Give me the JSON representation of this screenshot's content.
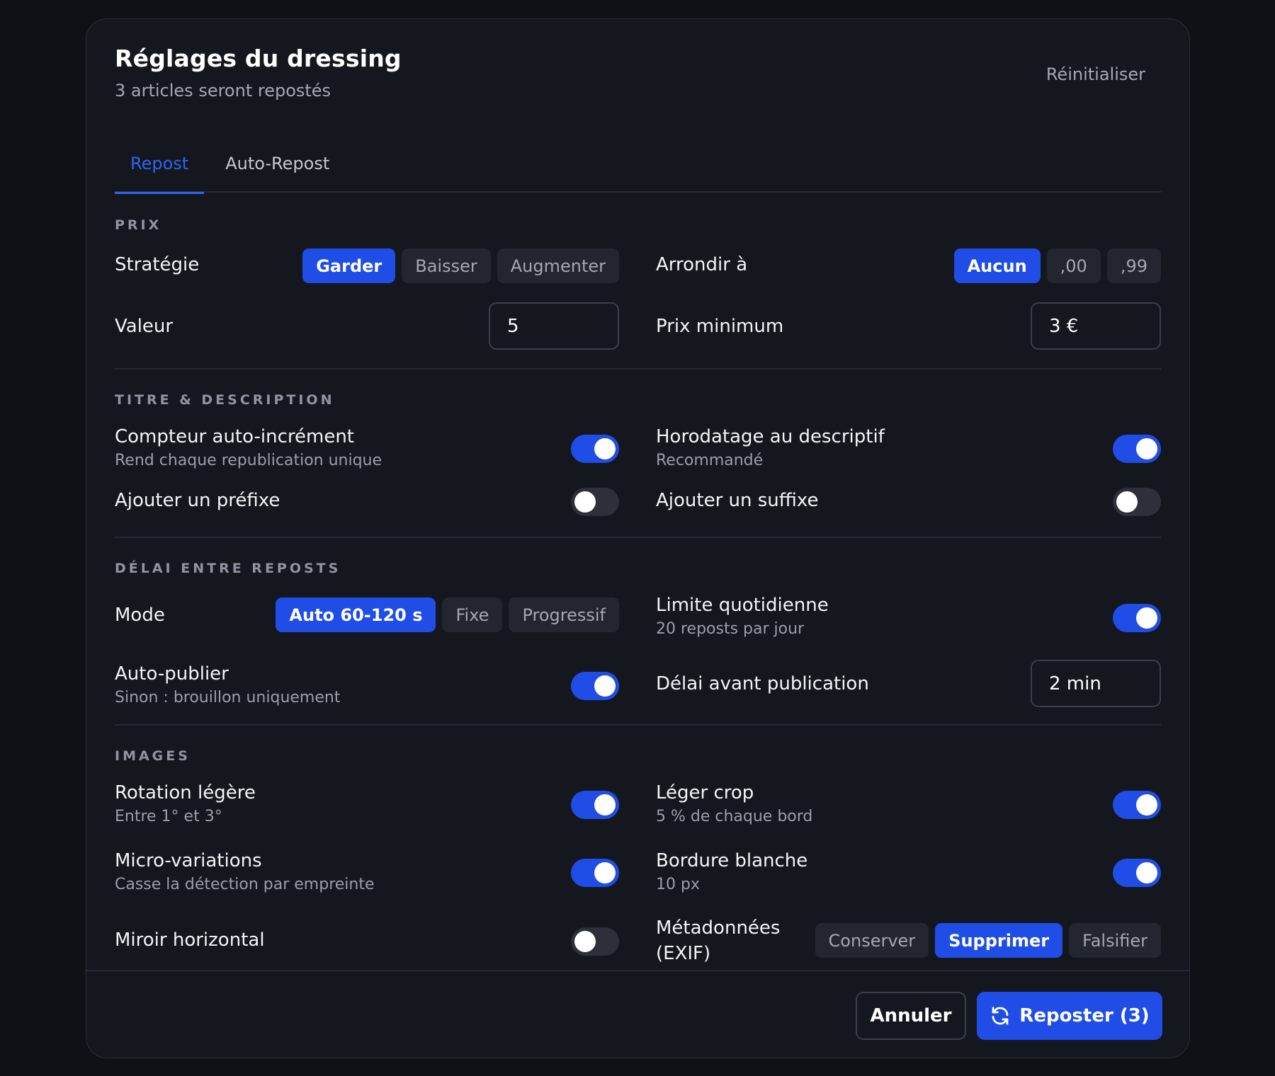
{
  "header": {
    "title": "Réglages du dressing",
    "subtitle": "3 articles seront repostés",
    "reset_label": "Réinitialiser"
  },
  "tabs": [
    {
      "label": "Repost",
      "active": true
    },
    {
      "label": "Auto-Repost",
      "active": false
    }
  ],
  "prix": {
    "section_label": "PRIX",
    "strategie": {
      "label": "Stratégie",
      "options": [
        "Garder",
        "Baisser",
        "Augmenter"
      ],
      "selected": "Garder"
    },
    "arrondir": {
      "label": "Arrondir à",
      "options": [
        "Aucun",
        ",00",
        ",99"
      ],
      "selected": "Aucun"
    },
    "valeur": {
      "label": "Valeur",
      "value": "5"
    },
    "prix_minimum": {
      "label": "Prix minimum",
      "value": "3 €"
    }
  },
  "titre": {
    "section_label": "TITRE & DESCRIPTION",
    "compteur": {
      "label": "Compteur auto-incrément",
      "sub": "Rend chaque republication unique",
      "on": true
    },
    "horodatage": {
      "label": "Horodatage au descriptif",
      "sub": "Recommandé",
      "on": true
    },
    "prefixe": {
      "label": "Ajouter un préfixe",
      "on": false
    },
    "suffixe": {
      "label": "Ajouter un suffixe",
      "on": false
    }
  },
  "delai": {
    "section_label": "DÉLAI ENTRE REPOSTS",
    "mode": {
      "label": "Mode",
      "options": [
        "Auto 60-120 s",
        "Fixe",
        "Progressif"
      ],
      "selected": "Auto 60-120 s"
    },
    "limite": {
      "label": "Limite quotidienne",
      "sub": "20 reposts par jour",
      "on": true
    },
    "auto_publier": {
      "label": "Auto-publier",
      "sub": "Sinon : brouillon uniquement",
      "on": true
    },
    "delai_publication": {
      "label": "Délai avant publication",
      "value": "2 min"
    }
  },
  "images": {
    "section_label": "IMAGES",
    "rotation": {
      "label": "Rotation légère",
      "sub": "Entre 1° et 3°",
      "on": true
    },
    "crop": {
      "label": "Léger crop",
      "sub": "5 % de chaque bord",
      "on": true
    },
    "micro": {
      "label": "Micro-variations",
      "sub": "Casse la détection par empreinte",
      "on": true
    },
    "bordure": {
      "label": "Bordure blanche",
      "sub": "10 px",
      "on": true
    },
    "miroir": {
      "label": "Miroir horizontal",
      "on": false
    },
    "metadonnees": {
      "label_line1": "Métadonnées",
      "label_line2": "(EXIF)",
      "options": [
        "Conserver",
        "Supprimer",
        "Falsifier"
      ],
      "selected": "Supprimer"
    }
  },
  "footer": {
    "cancel_label": "Annuler",
    "primary_label": "Reposter (3)",
    "primary_icon": "refresh-icon"
  },
  "colors": {
    "accent": "#1f4de6",
    "tab_active": "#2f63f4",
    "background": "#0f1116",
    "panel": "#15171e"
  }
}
